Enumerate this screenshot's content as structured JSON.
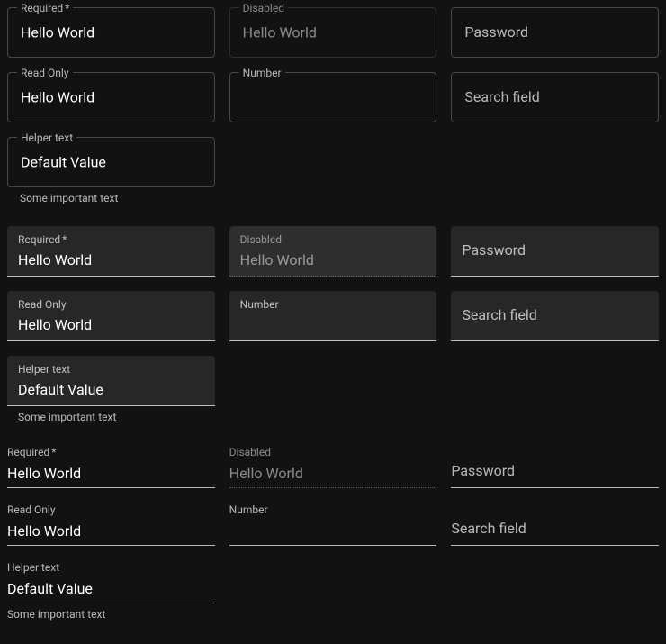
{
  "labels": {
    "required": "Required",
    "disabled": "Disabled",
    "password": "Password",
    "readonly": "Read Only",
    "number": "Number",
    "search": "Search field",
    "helpertext": "Helper text"
  },
  "values": {
    "hello": "Hello World",
    "defaultv": "Default Value"
  },
  "helper": "Some important text",
  "asterisk": "*"
}
